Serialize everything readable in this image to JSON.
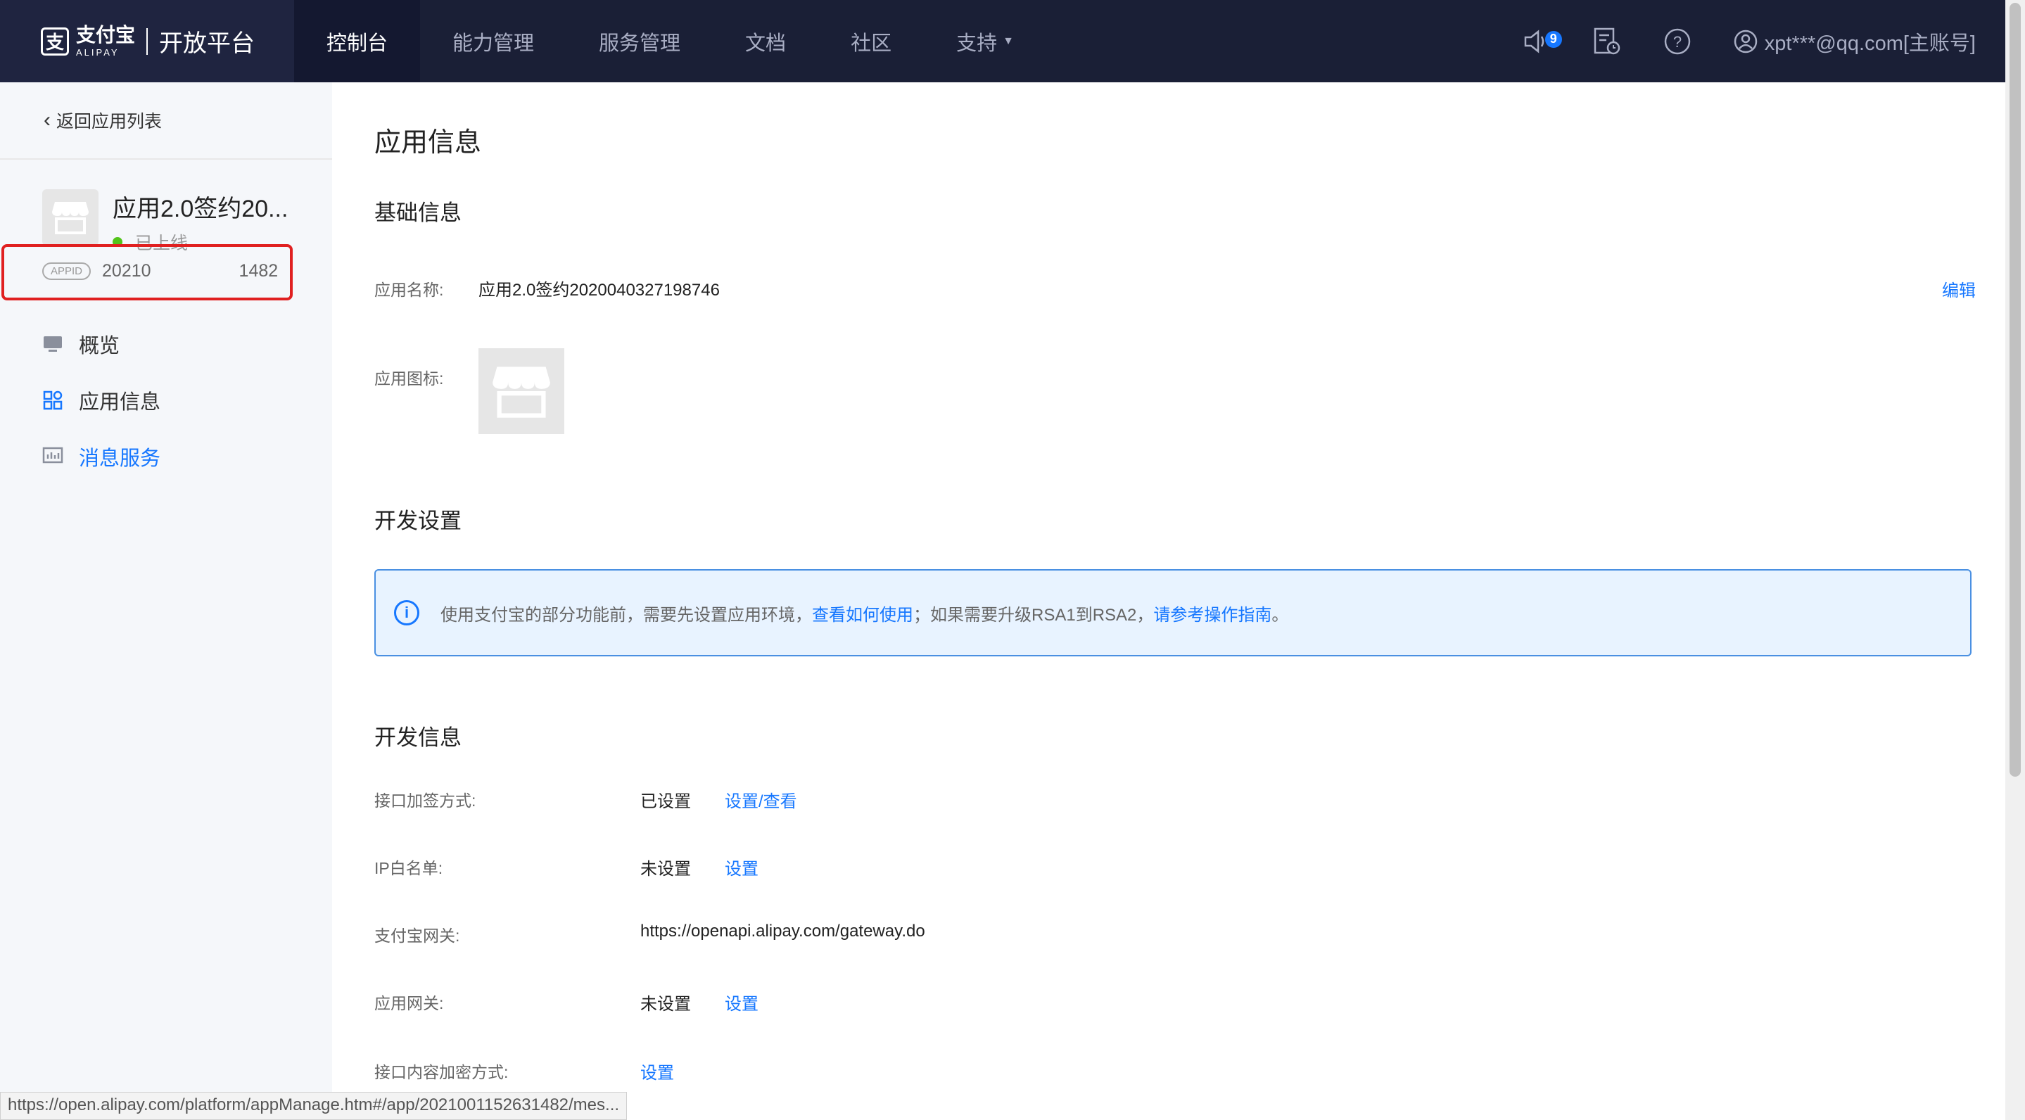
{
  "topnav": {
    "logo_cn": "支付宝",
    "logo_en": "ALIPAY",
    "title": "开放平台",
    "items": [
      {
        "label": "控制台"
      },
      {
        "label": "能力管理"
      },
      {
        "label": "服务管理"
      },
      {
        "label": "文档"
      },
      {
        "label": "社区"
      },
      {
        "label": "支持"
      }
    ],
    "notification_count": "9",
    "account": "xpt***@qq.com[主账号]"
  },
  "sidebar": {
    "back_label": "返回应用列表",
    "app_name": "应用2.0签约20...",
    "app_status": "已上线",
    "appid_tag": "APPID",
    "appid_value": "20210     1482",
    "menu": [
      {
        "label": "概览",
        "icon": "monitor-icon"
      },
      {
        "label": "应用信息",
        "icon": "grid-icon"
      },
      {
        "label": "消息服务",
        "icon": "chart-icon"
      }
    ]
  },
  "main": {
    "page_title": "应用信息",
    "basic_section": "基础信息",
    "app_name_label": "应用名称:",
    "app_name_value": "应用2.0签约2020040327198746",
    "edit_label": "编辑",
    "app_icon_label": "应用图标:",
    "dev_settings_section": "开发设置",
    "alert": {
      "text1": "使用支付宝的部分功能前，需要先设置应用环境，",
      "link1": "查看如何使用",
      "text2": "；如果需要升级RSA1到RSA2，",
      "link2": "请参考操作指南",
      "text3": "。"
    },
    "dev_info_section": "开发信息",
    "fields": [
      {
        "label": "接口加签方式:",
        "value": "已设置",
        "action": "设置/查看"
      },
      {
        "label": "IP白名单:",
        "value": "未设置",
        "action": "设置"
      },
      {
        "label": "支付宝网关:",
        "value": "https://openapi.alipay.com/gateway.do",
        "action": ""
      },
      {
        "label": "应用网关:",
        "value": "未设置",
        "action": "设置"
      },
      {
        "label": "接口内容加密方式:",
        "value": "",
        "action": "设置"
      }
    ]
  },
  "statusbar": {
    "url": "https://open.alipay.com/platform/appManage.htm#/app/2021001152631482/mes..."
  },
  "colors": {
    "nav_bg": "#1a1f36",
    "accent": "#1677ff",
    "highlight_box": "#e02020",
    "status_online": "#52c41a"
  }
}
